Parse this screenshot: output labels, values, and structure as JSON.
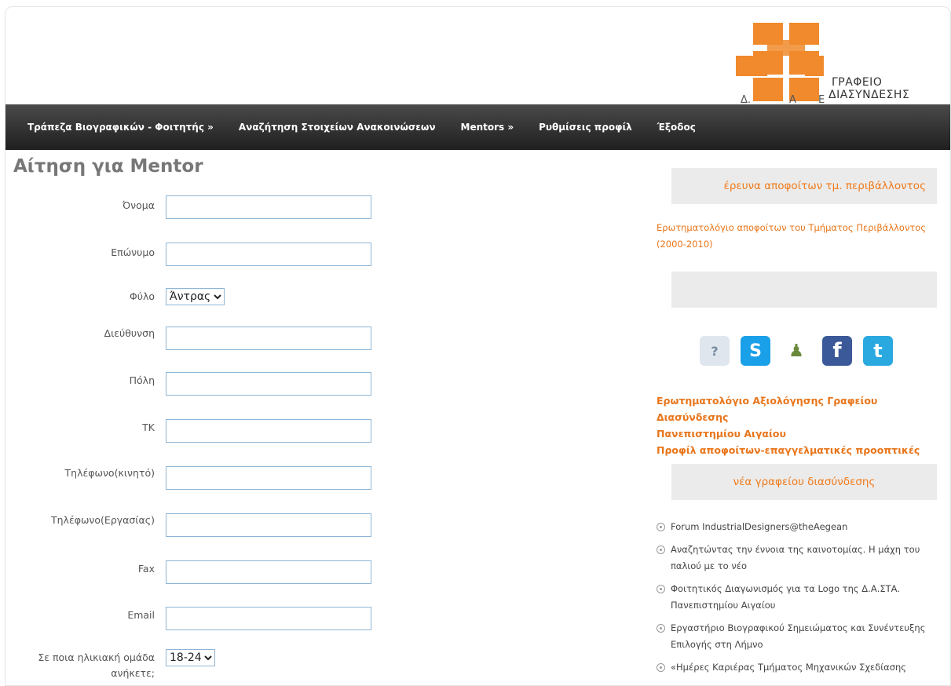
{
  "header": {
    "logo_text_line1": "ΓΡΑΦΕΙΟ",
    "logo_text_line2": "ΔΙΑΣΥΝΔΕΣΗΣ",
    "logo_partial": "Δ.",
    "logo_partial2": "Α",
    "logo_partial3": "Ε"
  },
  "nav": {
    "items": [
      "Τράπεζα Βιογραφικών - Φοιτητής »",
      "Αναζήτηση Στοιχείων Ανακοινώσεων",
      "Mentors »",
      "Ρυθμίσεις προφίλ",
      "Έξοδος"
    ]
  },
  "form": {
    "title": "Αίτηση για Mentor",
    "fields": {
      "name": "Όνομα",
      "surname": "Επώνυμο",
      "gender": "Φύλο",
      "address": "Διεύθυνση",
      "city": "Πόλη",
      "postcode": "ΤΚ",
      "mobile": "Τηλέφωνο(κινητό)",
      "work_phone": "Τηλέφωνο(Εργασίας)",
      "fax": "Fax",
      "email": "Email",
      "age_group_line1": "Σε ποια ηλικιακή ομάδα",
      "age_group_line2": "ανήκετε;"
    },
    "gender_selected": "Άντρας",
    "age_selected": "18-24"
  },
  "sidebar": {
    "box1_title": "έρευνα αποφοίτων τμ. περιβάλλοντος",
    "box1_link_line1": "Ερωτηματολόγιο αποφοίτων του Τμήματος Περιβάλλοντος",
    "box1_link_line2": "(2000-2010)",
    "box2_title": "",
    "social_icons": [
      "faq-icon",
      "skype-icon",
      "users-icon",
      "facebook-icon",
      "twitter-icon"
    ],
    "links": [
      "Ερωτηματολόγιο Αξιολόγησης Γραφείου Διασύνδεσης",
      "Πανεπιστημίου Αιγαίου",
      "Προφίλ αποφοίτων-επαγγελματικές προοπτικές"
    ],
    "news_title": "νέα γραφείου διασύνδεσης",
    "news": [
      "Forum IndustrialDesigners@theAegean",
      "Αναζητώντας την έννοια της καινοτομίας. Η μάχη του παλιού με το νέο",
      "Φοιτητικός Διαγωνισμός για τα Logo της Δ.Α.ΣΤΑ. Πανεπιστημίου Αιγαίου",
      "Εργαστήριο Βιογραφικού Σημειώματος και Συνέντευξης Επιλογής στη Λήμνο",
      "«Ημέρες Καριέρας Τμήματος Μηχανικών Σχεδίασης"
    ]
  }
}
